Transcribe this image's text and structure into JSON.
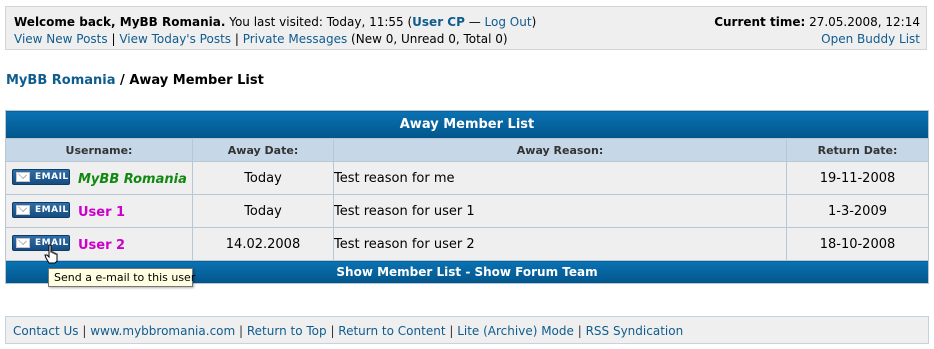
{
  "welcome": {
    "greeting": "Welcome back, MyBB Romania.",
    "visited": " You last visited: Today, 11:55 (",
    "user_cp": "User CP",
    "dash": " — ",
    "log_out": "Log Out",
    "close_paren": ")",
    "view_new_posts": "View New Posts",
    "view_todays_posts": "View Today's Posts",
    "private_messages": "Private Messages",
    "pm_counts": " (New 0, Unread 0, Total 0)",
    "current_time_label": "Current time:",
    "current_time_value": " 27.05.2008, 12:14",
    "open_buddy_list": "Open Buddy List"
  },
  "breadcrumb": {
    "home": "MyBB Romania",
    "separator": " / ",
    "current": "Away Member List"
  },
  "table": {
    "title": "Away Member List",
    "headers": [
      "Username:",
      "Away Date:",
      "Away Reason:",
      "Return Date:"
    ],
    "email_label": "EMAIL",
    "rows": [
      {
        "username": "MyBB Romania",
        "away_date": "Today",
        "reason": "Test reason for me",
        "return_date": "19-11-2008"
      },
      {
        "username": "User 1",
        "away_date": "Today",
        "reason": "Test reason for user 1",
        "return_date": "1-3-2009"
      },
      {
        "username": "User 2",
        "away_date": "14.02.2008",
        "reason": "Test reason for user 2",
        "return_date": "18-10-2008"
      }
    ],
    "footer": {
      "show_member_list": "Show Member List",
      "dash": " - ",
      "show_forum_team": "Show Forum Team"
    }
  },
  "tooltip": "Send a e-mail to this user",
  "bottom_links": {
    "contact_us": "Contact Us",
    "site": "www.mybbromania.com",
    "return_to_top": "Return to Top",
    "return_to_content": "Return to Content",
    "lite_mode": "Lite (Archive) Mode",
    "rss": "RSS Syndication",
    "sep": " | "
  },
  "colors": {
    "link": "#0f5c8e",
    "admin_username": "#118811",
    "mod_username": "#cc00cc",
    "header_bg": "#0066a2"
  }
}
